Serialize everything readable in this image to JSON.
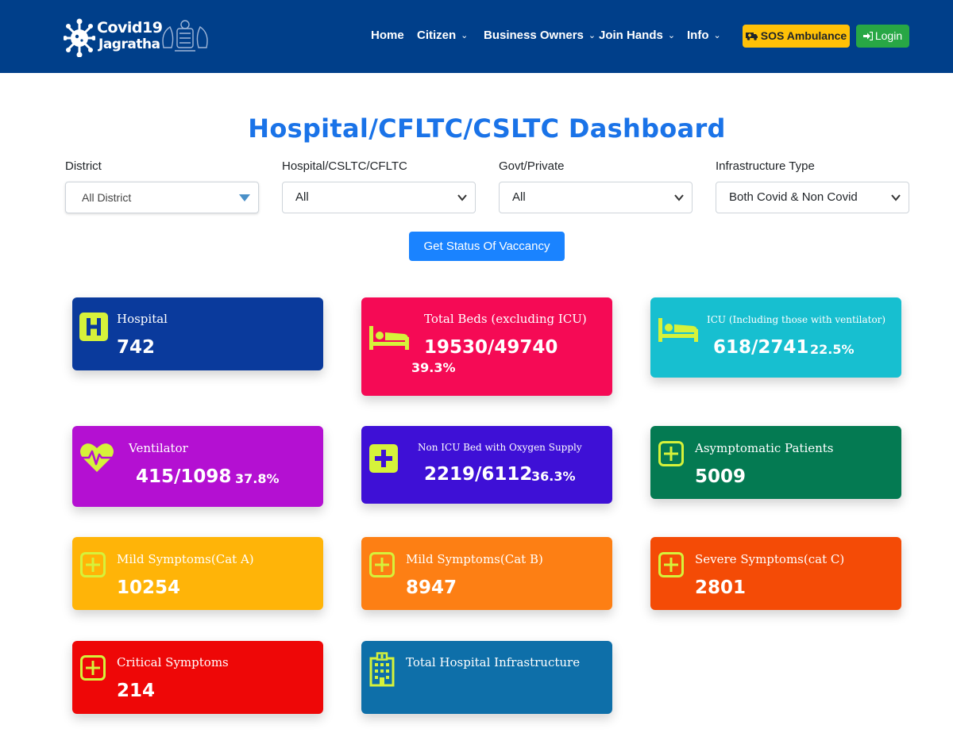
{
  "header": {
    "logo_line1": "Covid19",
    "logo_line2": "Jagratha",
    "nav": [
      {
        "label": "Home",
        "dropdown": false
      },
      {
        "label": "Citizen",
        "dropdown": true
      },
      {
        "label": "Business Owners",
        "dropdown": true
      },
      {
        "label": "Join Hands",
        "dropdown": true
      },
      {
        "label": "Info",
        "dropdown": true
      }
    ],
    "sos_label": "SOS Ambulance",
    "login_label": "Login",
    "chevron": "⌄"
  },
  "page": {
    "title": "Hospital/CFLTC/CSLTC Dashboard"
  },
  "filters": {
    "district": {
      "label": "District",
      "value": "All District"
    },
    "hospital_type": {
      "label": "Hospital/CSLTC/CFLTC",
      "value": "All"
    },
    "ownership": {
      "label": "Govt/Private",
      "value": "All"
    },
    "infrastructure": {
      "label": "Infrastructure Type",
      "value": "Both Covid & Non Covid"
    },
    "submit_label": "Get Status Of Vaccancy"
  },
  "cards": {
    "hospital": {
      "title": "Hospital",
      "value": "742",
      "color": "#0a3a9c",
      "icon": "hospital-h-icon"
    },
    "beds": {
      "title": "Total Beds (excluding ICU)",
      "value": "19530/49740",
      "pct": "39.3%",
      "color": "#f50a55",
      "icon": "bed-icon"
    },
    "icu": {
      "title": "ICU (Including those with ventilator)",
      "value": "618/2741",
      "pct": "22.5%",
      "color": "#17bfd0",
      "icon": "bed-icon"
    },
    "ventilator": {
      "title": "Ventilator",
      "value": "415/1098",
      "pct": "37.8%",
      "color": "#b410d2",
      "icon": "heartbeat-icon"
    },
    "oxygen": {
      "title": "Non ICU Bed with Oxygen Supply",
      "value": "2219/6112",
      "pct": "36.3%",
      "color": "#3e10d6",
      "icon": "plus-icon"
    },
    "asymptomatic": {
      "title": "Asymptomatic Patients",
      "value": "5009",
      "color": "#047a52",
      "icon": "plus-outline-icon"
    },
    "cat_a": {
      "title": "Mild Symptoms(Cat A)",
      "value": "10254",
      "color": "#ffb408",
      "icon": "plus-outline-icon"
    },
    "cat_b": {
      "title": "Mild Symptoms(Cat B)",
      "value": "8947",
      "color": "#fd7f14",
      "icon": "plus-outline-icon"
    },
    "cat_c": {
      "title": "Severe Symptoms(cat C)",
      "value": "2801",
      "color": "#f44b06",
      "icon": "plus-outline-icon"
    },
    "critical": {
      "title": "Critical Symptoms",
      "value": "214",
      "color": "#ee0707",
      "icon": "plus-outline-icon"
    },
    "infrastructure": {
      "title": "Total Hospital Infrastructure",
      "color": "#0e6fa9",
      "icon": "building-icon"
    }
  },
  "colors": {
    "header_bg": "#003f8a",
    "accent_icon": "#d6f23a",
    "title_blue": "#1a73e8"
  }
}
